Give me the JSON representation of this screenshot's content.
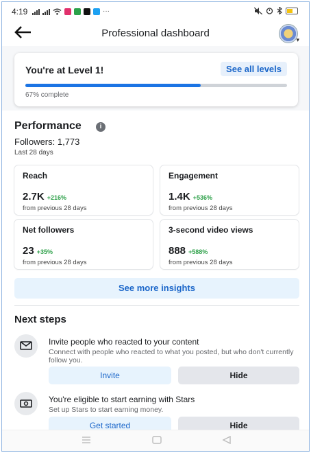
{
  "status_bar": {
    "time": "4:19"
  },
  "header": {
    "title": "Professional dashboard"
  },
  "level": {
    "title": "You're at Level 1!",
    "see_all": "See all levels",
    "progress_percent": 67,
    "progress_text": "67% complete"
  },
  "performance": {
    "title": "Performance",
    "followers": "Followers: 1,773",
    "period": "Last 28 days",
    "metrics": [
      {
        "label": "Reach",
        "value": "2.7K",
        "change": "+216%",
        "sub": "from previous 28 days"
      },
      {
        "label": "Engagement",
        "value": "1.4K",
        "change": "+536%",
        "sub": "from previous 28 days"
      },
      {
        "label": "Net followers",
        "value": "23",
        "change": "+35%",
        "sub": "from previous 28 days"
      },
      {
        "label": "3-second video views",
        "value": "888",
        "change": "+588%",
        "sub": "from previous 28 days"
      }
    ],
    "insights_button": "See more insights"
  },
  "next_steps": {
    "title": "Next steps",
    "items": [
      {
        "title": "Invite people who reacted to your content",
        "desc": "Connect with people who reacted to what you posted, but who don't currently follow you.",
        "primary": "Invite",
        "secondary": "Hide"
      },
      {
        "title": "You're eligible to start earning with Stars",
        "desc": "Set up Stars to start earning money.",
        "primary": "Get started",
        "secondary": "Hide"
      }
    ]
  },
  "colors": {
    "accent": "#1b74e4",
    "positive": "#31a24c",
    "button_bg": "#e7f3fd"
  }
}
